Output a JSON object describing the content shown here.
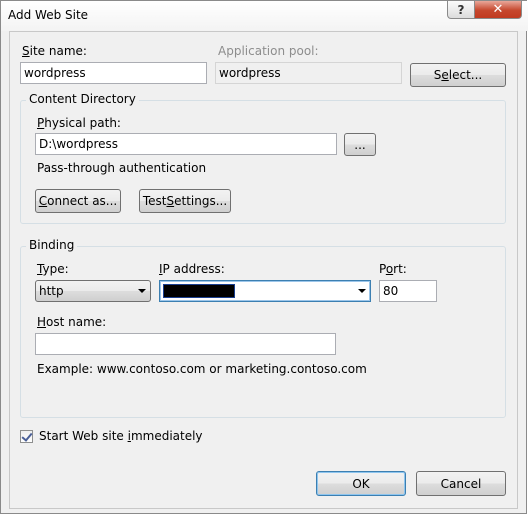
{
  "window": {
    "title": "Add Web Site",
    "help_glyph": "?",
    "close_glyph": "✕"
  },
  "site": {
    "name_label_key": "S",
    "name_label_rest": "ite name:",
    "name_value": "wordpress",
    "pool_label": "Application pool:",
    "pool_value": "wordpress",
    "select_label_key": "e",
    "select_label_pre": "S",
    "select_label_rest": "lect..."
  },
  "content_directory": {
    "title": "Content Directory",
    "path_label_key": "P",
    "path_label_rest": "hysical path:",
    "path_value": "D:\\wordpress",
    "browse_label": "...",
    "passthrough_label": "Pass-through authentication",
    "connect_label_key": "C",
    "connect_label_rest": "onnect as...",
    "test_label_pre": "Test ",
    "test_label_key": "S",
    "test_label_rest": "ettings..."
  },
  "binding": {
    "title": "Binding",
    "type_label_key": "T",
    "type_label_rest": "ype:",
    "type_value": "http",
    "ip_label_key": "I",
    "ip_label_rest": "P address:",
    "port_label_pre": "P",
    "port_label_key": "o",
    "port_label_rest": "rt:",
    "port_value": "80",
    "host_label_key": "H",
    "host_label_rest": "ost name:",
    "host_value": "",
    "example_text": "Example: www.contoso.com or marketing.contoso.com"
  },
  "start_immediately": {
    "checked": true,
    "label_pre": "Start Web site ",
    "label_key": "i",
    "label_rest": "mmediately"
  },
  "actions": {
    "ok_label": "OK",
    "cancel_label": "Cancel"
  }
}
